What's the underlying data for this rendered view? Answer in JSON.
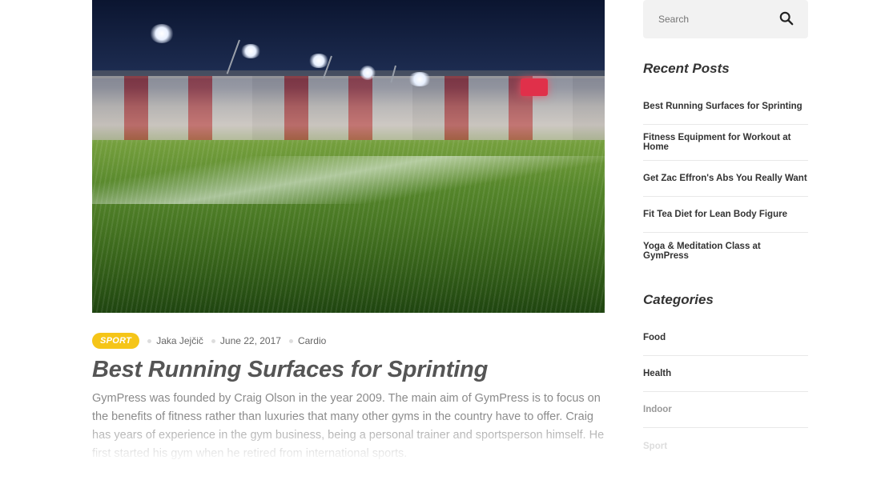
{
  "post": {
    "category_badge": "SPORT",
    "author": "Jaka Jejčič",
    "date": "June 22, 2017",
    "tag": "Cardio",
    "title": "Best Running Surfaces for Sprinting",
    "excerpt": "GymPress was founded by Craig Olson in the year 2009. The main aim of GymPress is to focus on the benefits of fitness rather than luxuries that many other gyms in the country have to offer. Craig has years of experience in the gym business, being a personal trainer and sportsperson himself. He first started his gym when he retired from international sports."
  },
  "sidebar": {
    "search": {
      "placeholder": "Search"
    },
    "recent_posts_title": "Recent Posts",
    "recent_posts": [
      "Best Running Surfaces for Sprinting",
      "Fitness Equipment for Workout at Home",
      "Get Zac Effron's Abs You Really Want",
      "Fit Tea Diet for Lean Body Figure",
      "Yoga & Meditation Class at GymPress"
    ],
    "categories_title": "Categories",
    "categories": [
      "Food",
      "Health",
      "Indoor",
      "Sport"
    ]
  },
  "colors": {
    "badge": "#f5c518",
    "title": "#555555",
    "text": "#8a8a8a"
  }
}
